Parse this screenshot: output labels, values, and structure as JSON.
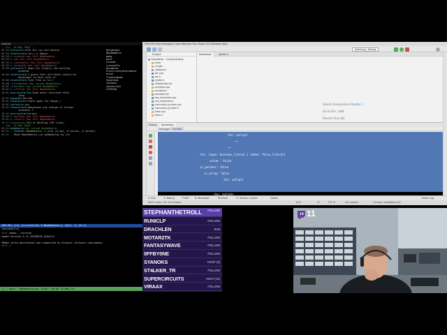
{
  "terminal": {
    "title": "twitch",
    "chat": [
      {
        "ts": "",
        "nick": "",
        "text": "-- Fri, 18 May 2018 --",
        "kind": "date"
      },
      {
        "ts": "09:59",
        "nick": "jonlaisle",
        "text": "with the run Attributes",
        "kind": "msg"
      },
      {
        "ts": "09:59",
        "nick": "renostalata",
        "text": "for(;;) Kappa",
        "kind": "msg"
      },
      {
        "ts": "09:59",
        "nick": "<-",
        "text": "suzasta has left #mybbdasta",
        "kind": "quit"
      },
      {
        "ts": "09:59",
        "nick": "<-",
        "text": "sxe has left #mybbdasta",
        "kind": "quit"
      },
      {
        "ts": "09:59",
        "nick": "<-",
        "text": "leoronator has left #mybbdasta",
        "kind": "quit"
      },
      {
        "ts": "09:59",
        "nick": "<-",
        "text": "buresyth has left #mybbdasta",
        "kind": "quit"
      },
      {
        "ts": "10:00",
        "nick": "jonlaisle",
        "text": "I hope its luckily the halting",
        "kind": "msg"
      },
      {
        "ts": "",
        "nick": "",
        "text": "problem",
        "kind": "cont"
      },
      {
        "ts": "10:00",
        "nick": "renostalata",
        "text": "I guess that attribute should be",
        "kind": "msg"
      },
      {
        "ts": "",
        "nick": "",
        "text": "developer to deal with it",
        "kind": "cont"
      },
      {
        "ts": "10:00",
        "nick": "renostalata",
        "text": "like free is to C",
        "kind": "msg"
      },
      {
        "ts": "10:00",
        "nick": "->",
        "text": "brokonesh has joined #mybbdasta",
        "kind": "join"
      },
      {
        "ts": "10:01",
        "nick": "->",
        "text": "borhess has joined #mybbdasta",
        "kind": "join"
      },
      {
        "ts": "10:01",
        "nick": "<-",
        "text": "sfflink has left #mybbdasta",
        "kind": "quit"
      },
      {
        "ts": "10:01",
        "nick": "jmurraystarted",
        "text": "Code never executed after",
        "kind": "msg"
      },
      {
        "ts": "",
        "nick": "",
        "text": "loop.",
        "kind": "cont"
      },
      {
        "ts": "10:01",
        "nick": "dsyanoks",
        "text": "Kon!Da",
        "kind": "msg"
      },
      {
        "ts": "10:01",
        "nick": "renostalata",
        "text": "there goes for Kappa /",
        "kind": "msg"
      },
      {
        "ts": "10:01",
        "nick": "jonlaisle",
        "text": "yes",
        "kind": "msg"
      },
      {
        "ts": "10:02",
        "nick": "renostalata",
        "text": "@dsyanoks any change of stream",
        "kind": "msg"
      },
      {
        "ts": "",
        "nick": "",
        "text": "schedule ?",
        "kind": "cont"
      },
      {
        "ts": "10:02",
        "nick": "jmurraystarted",
        "text": "bye",
        "kind": "msg"
      },
      {
        "ts": "10:02",
        "nick": "<-",
        "text": "kortnos has left #mybbdasta",
        "kind": "quit"
      },
      {
        "ts": "10:02",
        "nick": "<-",
        "text": "eloorit has left #mybbdasta",
        "kind": "quit"
      },
      {
        "ts": "10:??",
        "nick": "",
        "text": "========== End of Backlog (30 lines)",
        "kind": "msg"
      },
      {
        "ts": "",
        "nick": "",
        "text": "-- Sat, 19 May 2018 --",
        "kind": "date"
      },
      {
        "ts": "04:21",
        "nick": "mybbdasta",
        "text": "has joined #mybbdasta",
        "kind": "join"
      },
      {
        "ts": "04:21",
        "nick": "--",
        "text": "Channel #mybbdasta: 1 nick (0 ops, 0 voices, 0 normal)",
        "kind": "msg"
      },
      {
        "ts": "04:21",
        "nick": "--",
        "text": "Mode #mybbdasta [+o mybbdasta] by jtv",
        "kind": "msg"
      }
    ],
    "nicklist": [
      "@nightbot",
      "@mybbdasta",
      "aobs",
      "bzef",
      "corbob",
      "crocsyhlo",
      "dscomros",
      "electricaldstardeard",
      "evter",
      "floatingman",
      "hyberdsa",
      "iynaoss",
      "nosterival",
      "vSfKFdb"
    ],
    "status_bar": "[09:49] [+r] [irc/twitch] 2:#mybbdasta(+) [Act: 1] [0.1]",
    "prompt": "[#mybbdasta]",
    "shell": [
      {
        "ps": "Jeff ",
        "text": "cmake --version"
      },
      {
        "ps": "",
        "text": "cmake version 3.11.20180419-g7baff4"
      },
      {
        "ps": "",
        "text": ""
      },
      {
        "ps": "",
        "text": "CMake suite maintained and supported by Kitware (kitware.com/cmake)."
      },
      {
        "ps": "Jeff ",
        "text": "|"
      }
    ],
    "tmux_bar": "[] 1 bash*                          \"mybbdasta/gcc-local\" 09:49 19-May-18"
  },
  "ide": {
    "menubar": "File  Edit  View  Navigate  Code  Refactor  Run  Tools  VCS  Window  Help",
    "run_config": "jsonlang | Debug",
    "project_label": "Project",
    "editor_tabs": [
      "boostdesp",
      "parser.h"
    ],
    "tree": [
      "boostdesp ~/src/boostdesp",
      "build",
      "cmake",
      ".gitignore",
      "ast.cpp",
      "ast.h",
      "builtin.h",
      "CMakeLists.txt",
      "compiler.cpp",
      "compiler.h",
      "example.txt",
      "hex_formatter.cpp",
      "hex_formatter.h",
      "instruction_printer.cpp",
      "instruction_printer.h",
      "lexer.cpp",
      "lexer.h"
    ],
    "hints": [
      {
        "label": "Search Everywhere ",
        "key": "Double ⇧"
      },
      {
        "label": "Go to File ",
        "key": "⇧⌘N"
      },
      {
        "label": "Recent Files ",
        "key": "⌘E"
      }
    ],
    "debug_tabs": [
      "Debug:",
      "boostdesp"
    ],
    "debug_subtabs": [
      "Debugger",
      "Console"
    ],
    "console_lines": [
      {
        "indent": 100,
        "text": "lhs: nullptr"
      },
      {
        "indent": 110,
        "text": "~~"
      },
      {
        "indent": 100,
        "text": "~~"
      },
      {
        "indent": 60,
        "text": "rhs: (type: boolean_literal | token: false_literal)"
      },
      {
        "indent": 74,
        "text": "value: 'false'"
      },
      {
        "indent": 60,
        "text": "is_pointer: false"
      },
      {
        "indent": 66,
        "text": "is_array: false"
      },
      {
        "indent": 94,
        "text": "lhs: nullptr"
      }
    ],
    "console_bottom": [
      {
        "indent": 80,
        "text": "rhs: nullptr"
      },
      {
        "indent": 96,
        "text": "~~"
      }
    ],
    "bottom_tabs": [
      "4: Run",
      "5: Debug",
      "TODO",
      "6: Messages",
      "Terminal",
      "9: Version Control",
      "CMake"
    ],
    "status_bar": [
      "8424 chars, 151 line breaks",
      "8:51",
      "LF",
      "UTF-8",
      "Git: master",
      "Context: boostdesp [D]"
    ],
    "event_log": "Event Log"
  },
  "followers": [
    {
      "name": "STEPHANTHETROLL",
      "event": "FOLLOW"
    },
    {
      "name": "RUNICLP",
      "event": "FOLLOW"
    },
    {
      "name": "DRACHLEN",
      "event": "SUB"
    },
    {
      "name": "MOTAR2TK",
      "event": "FOLLOW"
    },
    {
      "name": "FANTASYWAVE",
      "event": "FOLLOW"
    },
    {
      "name": "0FFBY0NE",
      "event": "FOLLOW"
    },
    {
      "name": "SYANOKS",
      "event": "HOST (3)"
    },
    {
      "name": "ST4LKER_TR",
      "event": "FOLLOW"
    },
    {
      "name": "SUPERCIRCUITS",
      "event": "HOST (14)"
    },
    {
      "name": "VIRAAX",
      "event": "FOLLOW"
    }
  ],
  "webcam": {
    "viewer_count": "11",
    "badge_icon": "twitch-icon"
  },
  "colors": {
    "follower_bg": "#24164a",
    "follower_top": "#5a3ea8",
    "console_bg": "#5177b4",
    "twitch_purple": "#6441a4"
  }
}
